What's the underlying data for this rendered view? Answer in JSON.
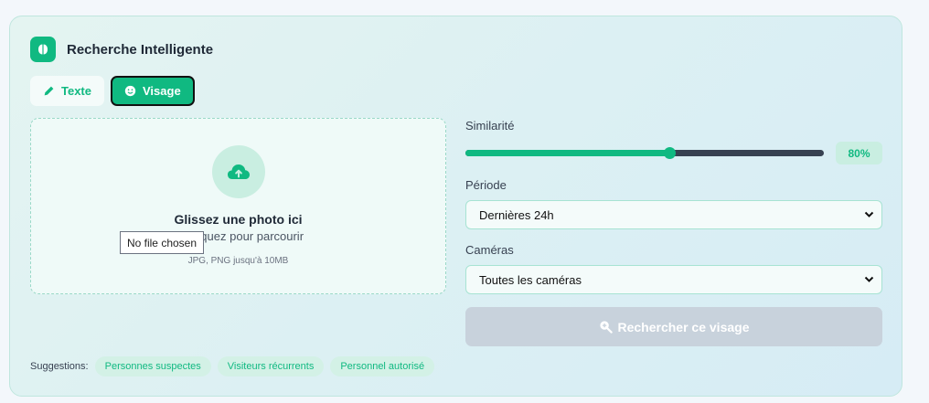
{
  "header": {
    "title": "Recherche Intelligente",
    "logo_icon": "brain-icon"
  },
  "tabs": [
    {
      "label": "Texte",
      "icon": "pencil-icon",
      "active": false
    },
    {
      "label": "Visage",
      "icon": "smiley-icon",
      "active": true
    }
  ],
  "upload": {
    "icon": "cloud-upload-icon",
    "title": "Glissez une photo ici",
    "subtitle": "ou cliquez pour parcourir",
    "hint": "JPG, PNG jusqu'à 10MB",
    "file_tooltip": "No file chosen"
  },
  "similarity": {
    "label": "Similarité",
    "value": 0.57,
    "display": "80%"
  },
  "period": {
    "label": "Période",
    "selected": "Dernières 24h"
  },
  "cameras": {
    "label": "Caméras",
    "selected": "Toutes les caméras"
  },
  "search_button": {
    "label": "Rechercher ce visage",
    "icon": "search-face-icon",
    "disabled": true
  },
  "suggestions": {
    "label": "Suggestions:",
    "chips": [
      "Personnes suspectes",
      "Visiteurs récurrents",
      "Personnel autorisé"
    ]
  },
  "colors": {
    "accent": "#10b981",
    "accent_light": "#c9eee1",
    "button_disabled": "#c8d2dc"
  }
}
